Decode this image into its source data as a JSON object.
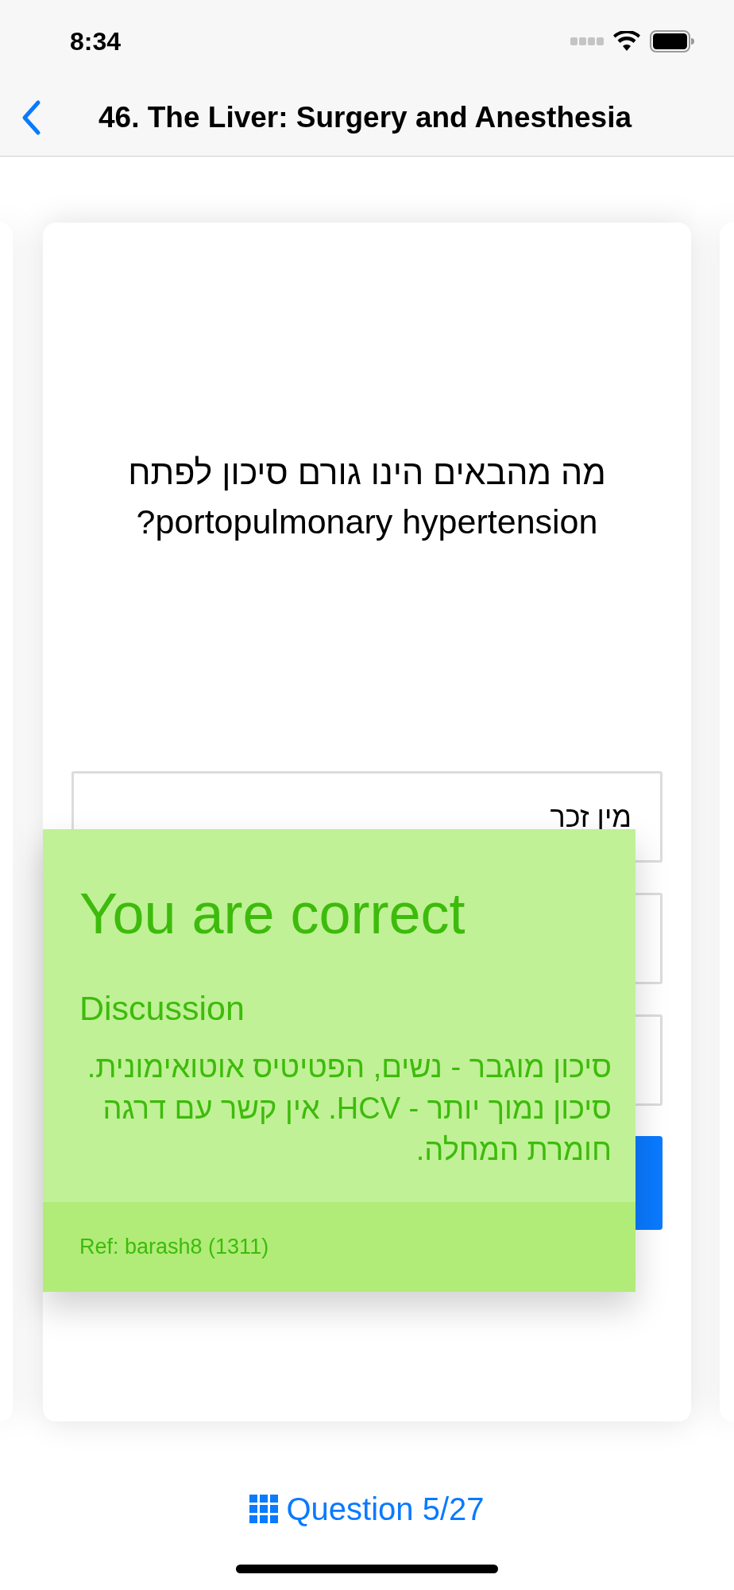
{
  "status_bar": {
    "time": "8:34"
  },
  "nav": {
    "title": "46. The Liver: Surgery and Anesthesia"
  },
  "question": {
    "text": "מה מהבאים הינו גורם סיכון לפתח portopulmonary hypertension?"
  },
  "answers": [
    {
      "kind": "option",
      "text": "מין זכר"
    },
    {
      "kind": "covered"
    },
    {
      "kind": "covered"
    }
  ],
  "feedback": {
    "correct": true,
    "title": "You are correct",
    "discussion_label": "Discussion",
    "discussion": "סיכון מוגבר - נשים, הפטיטיס אוטואימונית. סיכון נמוך יותר - HCV. אין קשר עם דרגה חומרת המחלה.",
    "ref": "Ref: barash8 (1311)"
  },
  "footer": {
    "progress": "Question 5/27"
  }
}
